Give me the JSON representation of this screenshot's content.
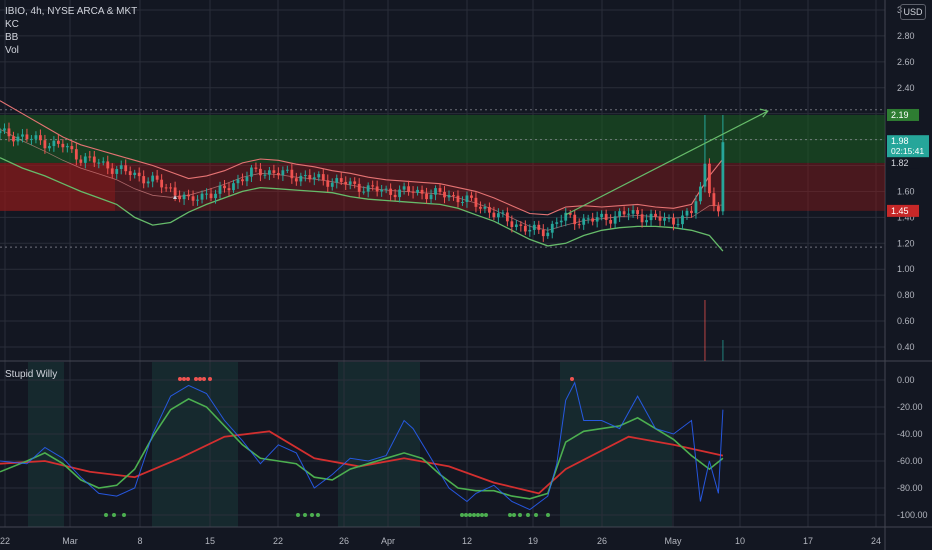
{
  "header": {
    "symbol": "IBIO, 4h, NYSE ARCA & MKT",
    "indicators": [
      "KC",
      "BB",
      "Vol"
    ],
    "currency": "USD"
  },
  "oscillator": {
    "title": "Stupid Willy"
  },
  "colors": {
    "background": "#131722",
    "up_candle": "#26a69a",
    "down_candle": "#ef5350",
    "green_zone": "#1b5e20",
    "red_zone": "#8b1a1a",
    "signal_line": "#4caf50",
    "slow_line": "#d32f2f",
    "raw_line": "#2962ff"
  },
  "price_labels": {
    "resistance": "2.19",
    "last": "1.98",
    "countdown": "02:15:41",
    "mid": "1.82",
    "support": "1.45"
  },
  "chart_data": [
    {
      "type": "candlestick",
      "title": "IBIO, 4h, NYSE ARCA & MKT",
      "y_ticks": [
        "3",
        "2.80",
        "2.60",
        "2.40",
        "2.20",
        "2.00",
        "1.80",
        "1.60",
        "1.40",
        "1.20",
        "1.00",
        "0.80",
        "0.60",
        "0.40"
      ],
      "ylim": [
        0.3,
        3.05
      ],
      "x_ticks": [
        "22",
        "Mar",
        "8",
        "15",
        "22",
        "26",
        "Apr",
        "12",
        "19",
        "26",
        "May",
        "10",
        "17",
        "24"
      ],
      "close_path": [
        [
          0,
          2.05
        ],
        [
          5,
          2.02
        ],
        [
          10,
          1.98
        ],
        [
          14,
          1.95
        ],
        [
          18,
          1.86
        ],
        [
          22,
          1.82
        ],
        [
          26,
          1.77
        ],
        [
          30,
          1.73
        ],
        [
          34,
          1.68
        ],
        [
          38,
          1.62
        ],
        [
          42,
          1.52
        ],
        [
          44,
          1.56
        ],
        [
          46,
          1.59
        ],
        [
          48,
          1.57
        ],
        [
          50,
          1.62
        ],
        [
          52,
          1.67
        ],
        [
          54,
          1.7
        ],
        [
          56,
          1.74
        ],
        [
          58,
          1.76
        ],
        [
          60,
          1.75
        ],
        [
          62,
          1.74
        ],
        [
          64,
          1.73
        ],
        [
          66,
          1.72
        ],
        [
          68,
          1.71
        ],
        [
          70,
          1.7
        ],
        [
          72,
          1.69
        ],
        [
          74,
          1.68
        ],
        [
          76,
          1.67
        ],
        [
          78,
          1.65
        ],
        [
          80,
          1.64
        ],
        [
          82,
          1.62
        ],
        [
          84,
          1.61
        ],
        [
          86,
          1.6
        ],
        [
          88,
          1.6
        ],
        [
          90,
          1.6
        ],
        [
          92,
          1.6
        ],
        [
          94,
          1.59
        ],
        [
          96,
          1.58
        ],
        [
          98,
          1.58
        ],
        [
          100,
          1.57
        ],
        [
          102,
          1.55
        ],
        [
          104,
          1.53
        ],
        [
          106,
          1.5
        ],
        [
          108,
          1.47
        ],
        [
          110,
          1.43
        ],
        [
          112,
          1.39
        ],
        [
          114,
          1.36
        ],
        [
          116,
          1.33
        ],
        [
          118,
          1.3
        ],
        [
          120,
          1.29
        ],
        [
          122,
          1.3
        ],
        [
          124,
          1.37
        ],
        [
          126,
          1.4
        ],
        [
          128,
          1.38
        ],
        [
          130,
          1.38
        ],
        [
          132,
          1.38
        ],
        [
          134,
          1.39
        ],
        [
          136,
          1.4
        ],
        [
          138,
          1.42
        ],
        [
          140,
          1.43
        ],
        [
          142,
          1.42
        ],
        [
          144,
          1.4
        ],
        [
          146,
          1.39
        ],
        [
          148,
          1.38
        ],
        [
          150,
          1.38
        ],
        [
          152,
          1.39
        ],
        [
          154,
          1.44
        ],
        [
          156,
          1.62
        ],
        [
          157,
          1.83
        ],
        [
          158,
          1.63
        ],
        [
          159,
          1.48
        ],
        [
          160,
          1.4
        ],
        [
          161,
          1.98
        ]
      ],
      "keltner_upper": [
        [
          0,
          2.3
        ],
        [
          5,
          2.2
        ],
        [
          10,
          2.1
        ],
        [
          14,
          2.02
        ],
        [
          18,
          1.96
        ],
        [
          22,
          1.92
        ],
        [
          26,
          1.88
        ],
        [
          30,
          1.84
        ],
        [
          34,
          1.8
        ],
        [
          38,
          1.75
        ],
        [
          42,
          1.7
        ],
        [
          46,
          1.72
        ],
        [
          50,
          1.76
        ],
        [
          54,
          1.82
        ],
        [
          58,
          1.85
        ],
        [
          62,
          1.84
        ],
        [
          66,
          1.81
        ],
        [
          70,
          1.79
        ],
        [
          74,
          1.76
        ],
        [
          78,
          1.74
        ],
        [
          82,
          1.71
        ],
        [
          86,
          1.69
        ],
        [
          90,
          1.68
        ],
        [
          94,
          1.67
        ],
        [
          98,
          1.66
        ],
        [
          102,
          1.63
        ],
        [
          106,
          1.6
        ],
        [
          110,
          1.55
        ],
        [
          114,
          1.49
        ],
        [
          118,
          1.43
        ],
        [
          122,
          1.42
        ],
        [
          126,
          1.48
        ],
        [
          130,
          1.49
        ],
        [
          134,
          1.48
        ],
        [
          138,
          1.49
        ],
        [
          142,
          1.5
        ],
        [
          146,
          1.48
        ],
        [
          150,
          1.47
        ],
        [
          154,
          1.5
        ],
        [
          158,
          1.72
        ],
        [
          161,
          1.85
        ]
      ],
      "keltner_lower": [
        [
          0,
          1.86
        ],
        [
          5,
          1.78
        ],
        [
          10,
          1.72
        ],
        [
          14,
          1.66
        ],
        [
          18,
          1.6
        ],
        [
          22,
          1.55
        ],
        [
          26,
          1.5
        ],
        [
          30,
          1.4
        ],
        [
          34,
          1.34
        ],
        [
          38,
          1.36
        ],
        [
          42,
          1.44
        ],
        [
          46,
          1.5
        ],
        [
          50,
          1.55
        ],
        [
          54,
          1.6
        ],
        [
          58,
          1.63
        ],
        [
          62,
          1.62
        ],
        [
          66,
          1.61
        ],
        [
          70,
          1.6
        ],
        [
          74,
          1.59
        ],
        [
          78,
          1.56
        ],
        [
          82,
          1.54
        ],
        [
          86,
          1.53
        ],
        [
          90,
          1.52
        ],
        [
          94,
          1.51
        ],
        [
          98,
          1.5
        ],
        [
          102,
          1.47
        ],
        [
          106,
          1.42
        ],
        [
          110,
          1.37
        ],
        [
          114,
          1.3
        ],
        [
          118,
          1.23
        ],
        [
          122,
          1.18
        ],
        [
          126,
          1.2
        ],
        [
          130,
          1.26
        ],
        [
          134,
          1.3
        ],
        [
          138,
          1.32
        ],
        [
          142,
          1.33
        ],
        [
          146,
          1.33
        ],
        [
          150,
          1.32
        ],
        [
          154,
          1.3
        ],
        [
          158,
          1.26
        ],
        [
          161,
          1.14
        ]
      ],
      "trend_line": [
        [
          126,
          1.42
        ],
        [
          171,
          2.22
        ]
      ],
      "horizontal_levels": [
        2.19,
        1.82,
        1.45
      ],
      "volume_spike_index": 157
    },
    {
      "type": "line",
      "title": "Stupid Willy",
      "y_ticks": [
        "0.00",
        "-20.00",
        "-40.00",
        "-60.00",
        "-80.00",
        "-100.00"
      ],
      "ylim": [
        -105,
        5
      ],
      "series": [
        {
          "values": [
            [
              0,
              -60
            ],
            [
              6,
              -62
            ],
            [
              10,
              -50
            ],
            [
              14,
              -58
            ],
            [
              18,
              -72
            ],
            [
              22,
              -84
            ],
            [
              26,
              -86
            ],
            [
              30,
              -80
            ],
            [
              34,
              -40
            ],
            [
              38,
              -12
            ],
            [
              42,
              -4
            ],
            [
              46,
              -10
            ],
            [
              50,
              -30
            ],
            [
              54,
              -45
            ],
            [
              58,
              -62
            ],
            [
              62,
              -48
            ],
            [
              66,
              -54
            ],
            [
              70,
              -80
            ],
            [
              74,
              -70
            ],
            [
              78,
              -58
            ],
            [
              82,
              -60
            ],
            [
              86,
              -56
            ],
            [
              90,
              -30
            ],
            [
              92,
              -36
            ],
            [
              96,
              -58
            ],
            [
              100,
              -80
            ],
            [
              104,
              -90
            ],
            [
              106,
              -84
            ],
            [
              110,
              -78
            ],
            [
              114,
              -90
            ],
            [
              118,
              -96
            ],
            [
              122,
              -86
            ],
            [
              124,
              -62
            ],
            [
              126,
              -15
            ],
            [
              128,
              -2
            ],
            [
              130,
              -30
            ],
            [
              134,
              -30
            ],
            [
              138,
              -36
            ],
            [
              142,
              -12
            ],
            [
              146,
              -36
            ],
            [
              150,
              -40
            ],
            [
              154,
              -30
            ],
            [
              156,
              -90
            ],
            [
              158,
              -60
            ],
            [
              160,
              -84
            ],
            [
              161,
              -22
            ]
          ]
        },
        {
          "values": [
            [
              0,
              -68
            ],
            [
              6,
              -60
            ],
            [
              10,
              -54
            ],
            [
              14,
              -62
            ],
            [
              18,
              -74
            ],
            [
              22,
              -80
            ],
            [
              26,
              -78
            ],
            [
              30,
              -66
            ],
            [
              34,
              -42
            ],
            [
              38,
              -22
            ],
            [
              42,
              -14
            ],
            [
              46,
              -20
            ],
            [
              50,
              -34
            ],
            [
              54,
              -48
            ],
            [
              58,
              -58
            ],
            [
              62,
              -60
            ],
            [
              66,
              -62
            ],
            [
              70,
              -72
            ],
            [
              74,
              -74
            ],
            [
              78,
              -66
            ],
            [
              82,
              -62
            ],
            [
              86,
              -58
            ],
            [
              90,
              -54
            ],
            [
              94,
              -58
            ],
            [
              98,
              -70
            ],
            [
              102,
              -80
            ],
            [
              106,
              -82
            ],
            [
              110,
              -82
            ],
            [
              114,
              -86
            ],
            [
              118,
              -88
            ],
            [
              122,
              -84
            ],
            [
              126,
              -46
            ],
            [
              130,
              -38
            ],
            [
              134,
              -36
            ],
            [
              138,
              -34
            ],
            [
              142,
              -28
            ],
            [
              146,
              -36
            ],
            [
              150,
              -44
            ],
            [
              154,
              -56
            ],
            [
              158,
              -66
            ],
            [
              161,
              -58
            ]
          ]
        },
        {
          "values": [
            [
              0,
              -62
            ],
            [
              10,
              -60
            ],
            [
              20,
              -68
            ],
            [
              30,
              -72
            ],
            [
              40,
              -58
            ],
            [
              50,
              -42
            ],
            [
              60,
              -38
            ],
            [
              70,
              -58
            ],
            [
              80,
              -64
            ],
            [
              90,
              -58
            ],
            [
              100,
              -64
            ],
            [
              110,
              -76
            ],
            [
              120,
              -84
            ],
            [
              126,
              -66
            ],
            [
              140,
              -42
            ],
            [
              150,
              -48
            ],
            [
              161,
              -56
            ]
          ]
        }
      ]
    }
  ]
}
